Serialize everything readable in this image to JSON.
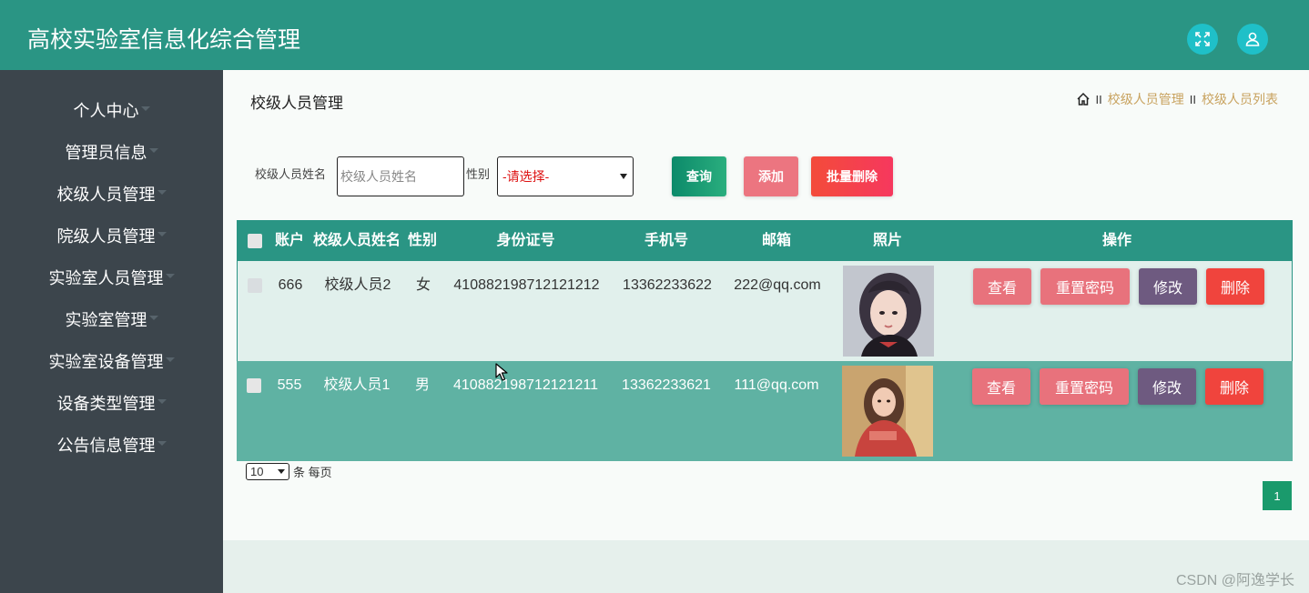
{
  "app": {
    "title": "高校实验室信息化综合管理"
  },
  "header": {
    "expand_icon": "fullscreen-icon",
    "user_icon": "user-icon",
    "accent": "#2a9584"
  },
  "sidebar": {
    "items": [
      {
        "label": "个人中心"
      },
      {
        "label": "管理员信息"
      },
      {
        "label": "校级人员管理"
      },
      {
        "label": "院级人员管理"
      },
      {
        "label": "实验室人员管理"
      },
      {
        "label": "实验室管理"
      },
      {
        "label": "实验室设备管理"
      },
      {
        "label": "设备类型管理"
      },
      {
        "label": "公告信息管理"
      }
    ]
  },
  "main": {
    "page_title": "校级人员管理",
    "breadcrumb": {
      "home_icon": "home-icon",
      "sep": "II",
      "items": [
        "校级人员管理",
        "校级人员列表"
      ]
    }
  },
  "search": {
    "name_label": "校级人员姓名",
    "name_placeholder": "校级人员姓名",
    "name_value": "",
    "gender_label": "性别",
    "gender_selected": "-请选择-",
    "query_label": "查询",
    "add_label": "添加",
    "bulk_delete_label": "批量删除"
  },
  "table": {
    "headers": [
      "账户",
      "校级人员姓名",
      "性别",
      "身份证号",
      "手机号",
      "邮箱",
      "照片",
      "操作"
    ],
    "rows": [
      {
        "account": "666",
        "name": "校级人员2",
        "gender": "女",
        "id_number": "410882198712121212",
        "phone": "13362233622",
        "email": "222@qq.com"
      },
      {
        "account": "555",
        "name": "校级人员1",
        "gender": "男",
        "id_number": "410882198712121211",
        "phone": "13362233621",
        "email": "111@qq.com"
      }
    ],
    "actions": {
      "view": "查看",
      "reset": "重置密码",
      "edit": "修改",
      "delete": "删除"
    }
  },
  "pagination": {
    "page_size": "10",
    "per_page_text": "条 每页",
    "current_page": "1"
  },
  "watermark": "CSDN @阿逸学长"
}
